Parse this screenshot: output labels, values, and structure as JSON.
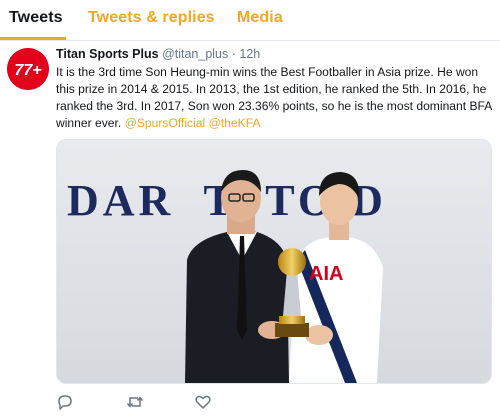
{
  "tabs": [
    {
      "label": "Tweets",
      "active": true
    },
    {
      "label": "Tweets & replies",
      "active": false
    },
    {
      "label": "Media",
      "active": false
    }
  ],
  "colors": {
    "accent": "#f5a623",
    "text": "#14171a",
    "muted": "#657786",
    "avatar_bg": "#e3001b"
  },
  "tweet": {
    "author": {
      "name": "Titan Sports Plus",
      "handle": "@titan_plus",
      "avatar_text": "77+"
    },
    "separator": "·",
    "time": "12h",
    "text": "It is the 3rd time Son Heung-min wins the Best Footballer in Asia prize. He won this prize in 2014 & 2015. In 2013, the 1st edition, he ranked the 5th. In 2016, he ranked the 3rd. In 2017, Son won 23.36% points, so he is the most dominant BFA winner ever.",
    "mentions": [
      "@SpursOfficial",
      "@theKFA"
    ],
    "media": {
      "wall_text": "DAR  T  TO D",
      "shirt_text": "AIA"
    },
    "actions": [
      {
        "icon": "reply-icon"
      },
      {
        "icon": "retweet-icon"
      },
      {
        "icon": "like-icon"
      }
    ]
  }
}
